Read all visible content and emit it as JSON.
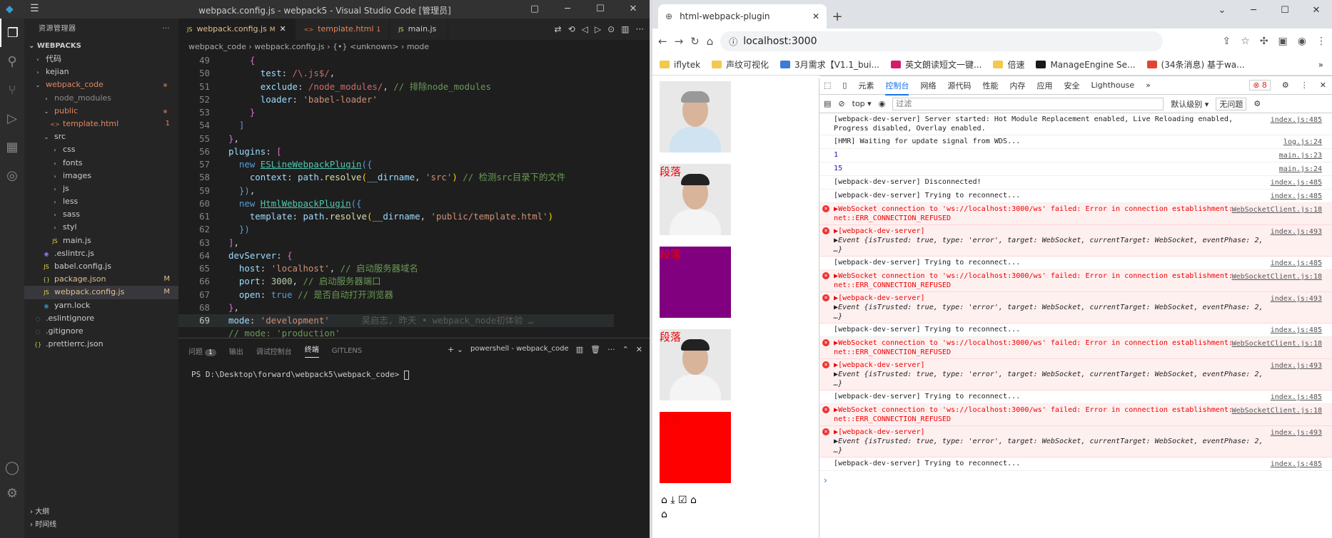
{
  "vscode": {
    "title": "webpack.config.js - webpack5 - Visual Studio Code [管理员]",
    "explorer_title": "资源管理器",
    "workspace": "WEBPACKS",
    "tree": [
      {
        "label": "代码",
        "indent": 1,
        "type": "folder"
      },
      {
        "label": "kejian",
        "indent": 1,
        "type": "folder"
      },
      {
        "label": "webpack_code",
        "indent": 1,
        "type": "folder-open",
        "color": "#e2875d",
        "dot": true
      },
      {
        "label": "node_modules",
        "indent": 2,
        "type": "folder",
        "color": "#8b8b8b"
      },
      {
        "label": "public",
        "indent": 2,
        "type": "folder-open",
        "color": "#e2875d",
        "dot": true
      },
      {
        "label": "template.html",
        "indent": 3,
        "type": "html",
        "color": "#e2875d",
        "badge": "1"
      },
      {
        "label": "src",
        "indent": 2,
        "type": "folder-open"
      },
      {
        "label": "css",
        "indent": 3,
        "type": "folder"
      },
      {
        "label": "fonts",
        "indent": 3,
        "type": "folder"
      },
      {
        "label": "images",
        "indent": 3,
        "type": "folder"
      },
      {
        "label": "js",
        "indent": 3,
        "type": "folder"
      },
      {
        "label": "less",
        "indent": 3,
        "type": "folder"
      },
      {
        "label": "sass",
        "indent": 3,
        "type": "folder"
      },
      {
        "label": "styl",
        "indent": 3,
        "type": "folder"
      },
      {
        "label": "main.js",
        "indent": 3,
        "type": "js"
      },
      {
        "label": ".eslintrc.js",
        "indent": 2,
        "type": "eslint"
      },
      {
        "label": "babel.config.js",
        "indent": 2,
        "type": "js"
      },
      {
        "label": "package.json",
        "indent": 2,
        "type": "json",
        "color": "#e2c08d",
        "badge": "M"
      },
      {
        "label": "webpack.config.js",
        "indent": 2,
        "type": "js",
        "color": "#e2c08d",
        "badge": "M",
        "active": true
      },
      {
        "label": "yarn.lock",
        "indent": 2,
        "type": "yarn"
      },
      {
        "label": ".eslintignore",
        "indent": 1,
        "type": "file"
      },
      {
        "label": ".gitignore",
        "indent": 1,
        "type": "file"
      },
      {
        "label": ".prettierrc.json",
        "indent": 1,
        "type": "json"
      }
    ],
    "tabs": [
      {
        "label": "webpack.config.js",
        "mark": "M",
        "active": true
      },
      {
        "label": "template.html",
        "mark": "1"
      },
      {
        "label": "main.js",
        "mark": ""
      }
    ],
    "breadcrumb": "webpack_code  ›  webpack.config.js  ›  {•} <unknown>  ›  mode",
    "cursor_line": 69,
    "git_blame": "吴启志, 昨天 • webpack_node初体验 …",
    "panel_tabs": [
      "问题",
      "输出",
      "调试控制台",
      "终端",
      "GITLENS"
    ],
    "panel_badge": "1",
    "terminal_name": "powershell - webpack_code",
    "terminal_prompt": "PS D:\\Desktop\\forward\\webpack5\\webpack_code> ",
    "outline": "大纲",
    "timeline": "时间线"
  },
  "chrome": {
    "tab_title": "html-webpack-plugin",
    "url": "localhost:3000",
    "bookmarks": [
      "iflytek",
      "声纹可视化",
      "3月需求【V1.1_bui...",
      "英文朗读短文一键...",
      "倍速",
      "ManageEngine Se...",
      "(34条消息) 基于wa..."
    ],
    "page": {
      "para": "段落",
      "imgs": [
        {
          "kind": "photo",
          "label": false
        },
        {
          "kind": "photo",
          "label": true
        },
        {
          "kind": "color",
          "color": "#800080",
          "label": true
        },
        {
          "kind": "photo",
          "label": true
        },
        {
          "kind": "color",
          "color": "#ff0000",
          "label": true
        }
      ]
    },
    "devtools": {
      "tabs": [
        "元素",
        "控制台",
        "网络",
        "源代码",
        "性能",
        "内存",
        "应用",
        "安全",
        "Lighthouse"
      ],
      "active_tab": "控制台",
      "error_count": "8",
      "context": "top",
      "filter_placeholder": "过滤",
      "level": "默认级别",
      "issues": "无问题",
      "logs": [
        {
          "type": "info",
          "text": "[webpack-dev-server] Server started: Hot Module Replacement enabled, Live Reloading enabled, Progress disabled, Overlay enabled.",
          "src": "index.js:485"
        },
        {
          "type": "info",
          "text": "[HMR] Waiting for update signal from WDS...",
          "src": "log.js:24"
        },
        {
          "type": "num",
          "text": "1",
          "src": "main.js:23"
        },
        {
          "type": "num",
          "text": "15",
          "src": "main.js:24"
        },
        {
          "type": "info",
          "text": "[webpack-dev-server] Disconnected!",
          "src": "index.js:485"
        },
        {
          "type": "info",
          "text": "[webpack-dev-server] Trying to reconnect...",
          "src": "index.js:485"
        },
        {
          "type": "ws",
          "text": "▶WebSocket connection to 'ws://localhost:3000/ws' failed: Error in connection establishment: net::ERR_CONNECTION_REFUSED",
          "src": "WebSocketClient.js:18"
        },
        {
          "type": "evt",
          "text": "▶[webpack-dev-server]",
          "sub": "▶Event {isTrusted: true, type: 'error', target: WebSocket, currentTarget: WebSocket, eventPhase: 2, …}",
          "src": "index.js:493"
        },
        {
          "type": "info",
          "text": "[webpack-dev-server] Trying to reconnect...",
          "src": "index.js:485"
        },
        {
          "type": "ws",
          "text": "▶WebSocket connection to 'ws://localhost:3000/ws' failed: Error in connection establishment: net::ERR_CONNECTION_REFUSED",
          "src": "WebSocketClient.js:18"
        },
        {
          "type": "evt",
          "text": "▶[webpack-dev-server]",
          "sub": "▶Event {isTrusted: true, type: 'error', target: WebSocket, currentTarget: WebSocket, eventPhase: 2, …}",
          "src": "index.js:493"
        },
        {
          "type": "info",
          "text": "[webpack-dev-server] Trying to reconnect...",
          "src": "index.js:485"
        },
        {
          "type": "ws",
          "text": "▶WebSocket connection to 'ws://localhost:3000/ws' failed: Error in connection establishment: net::ERR_CONNECTION_REFUSED",
          "src": "WebSocketClient.js:18"
        },
        {
          "type": "evt",
          "text": "▶[webpack-dev-server]",
          "sub": "▶Event {isTrusted: true, type: 'error', target: WebSocket, currentTarget: WebSocket, eventPhase: 2, …}",
          "src": "index.js:493"
        },
        {
          "type": "info",
          "text": "[webpack-dev-server] Trying to reconnect...",
          "src": "index.js:485"
        },
        {
          "type": "ws",
          "text": "▶WebSocket connection to 'ws://localhost:3000/ws' failed: Error in connection establishment: net::ERR_CONNECTION_REFUSED",
          "src": "WebSocketClient.js:18"
        },
        {
          "type": "evt",
          "text": "▶[webpack-dev-server]",
          "sub": "▶Event {isTrusted: true, type: 'error', target: WebSocket, currentTarget: WebSocket, eventPhase: 2, …}",
          "src": "index.js:493"
        },
        {
          "type": "info",
          "text": "[webpack-dev-server] Trying to reconnect...",
          "src": "index.js:485"
        }
      ]
    }
  }
}
